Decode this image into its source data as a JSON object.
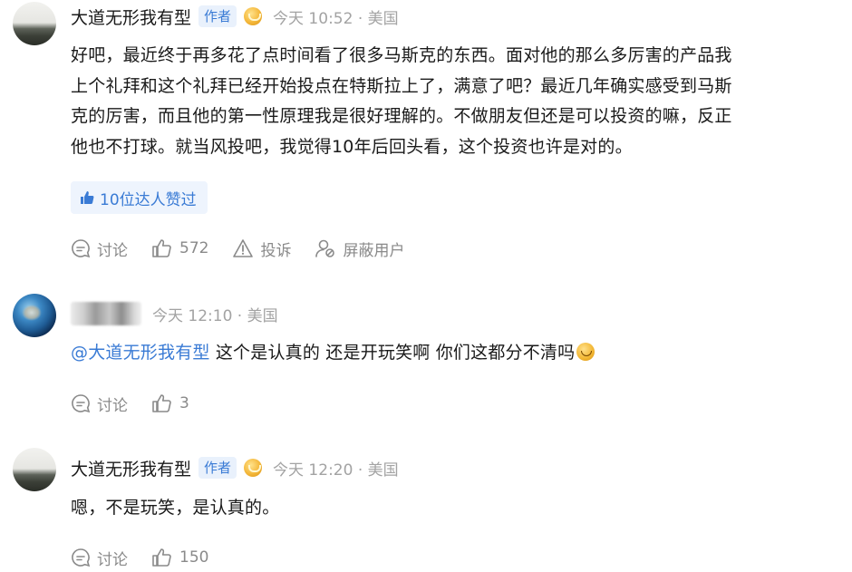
{
  "comments": [
    {
      "name": "大道无形我有型",
      "badge": "作者",
      "meta": "今天 10:52 · 美国",
      "lines": [
        "好吧，最近终于再多花了点时间看了很多马斯克的东西。面对他的那么多厉害的产品我",
        "上个礼拜和这个礼拜已经开始投点在特斯拉上了，满意了吧？最近几年确实感受到马斯",
        "克的厉害，而且他的第一性原理我是很好理解的。不做朋友但还是可以投资的嘛，反正",
        "他也不打球。就当风投吧，我觉得10年后回头看，这个投资也许是对的。"
      ],
      "likes_pill": "10位达人赞过",
      "reply_label": "讨论",
      "like_count": "572",
      "report_label": "投诉",
      "block_label": "屏蔽用户"
    },
    {
      "meta": "今天 12:10 · 美国",
      "mention": "@大道无形我有型",
      "text": " 这个是认真的 还是开玩笑啊 你们这都分不清吗",
      "reply_label": "讨论",
      "like_count": "3"
    },
    {
      "name": "大道无形我有型",
      "badge": "作者",
      "meta": "今天 12:20 · 美国",
      "text": "嗯，不是玩笑，是认真的。",
      "reply_label": "讨论",
      "like_count": "150"
    }
  ],
  "colors": {
    "accent": "#3a7bd5",
    "muted": "#a3a3a3",
    "action": "#8a8a8a"
  }
}
